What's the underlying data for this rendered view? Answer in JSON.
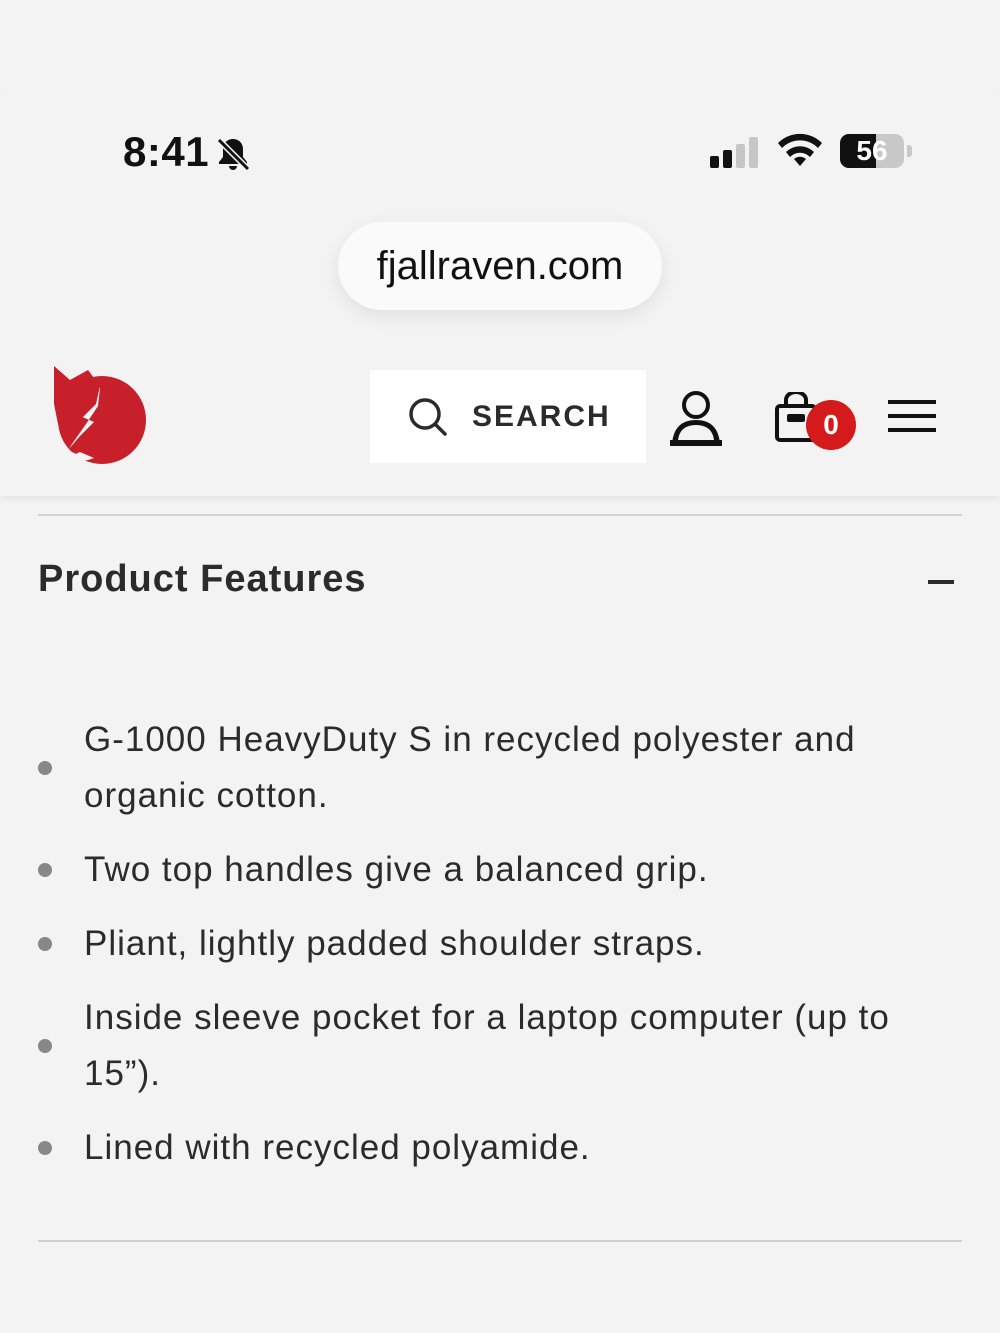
{
  "status_bar": {
    "time": "8:41",
    "battery_level": "56",
    "battery_fraction": 0.56,
    "icons": [
      "bell-slash-icon",
      "cellular-signal-icon",
      "wifi-icon",
      "battery-icon"
    ]
  },
  "browser": {
    "url": "fjallraven.com"
  },
  "header": {
    "logo_icon": "fjallraven-fox-logo",
    "search_label": "SEARCH",
    "account_icon": "user-icon",
    "cart_icon": "shopping-bag-icon",
    "cart_count": "0",
    "menu_icon": "hamburger-menu-icon"
  },
  "section": {
    "title": "Product Features",
    "toggle_icon": "minus-icon",
    "features": [
      "G-1000 HeavyDuty S in recycled polyester and organic cotton.",
      "Two top handles give a balanced grip.",
      "Pliant, lightly padded shoulder straps.",
      "Inside sleeve pocket for a laptop computer (up to 15”).",
      "Lined with recycled polyamide."
    ]
  },
  "colors": {
    "brand_red": "#c8202a",
    "badge_red": "#d41a1a",
    "page_background": "#f3f3f3",
    "text": "#2b2b2b"
  }
}
